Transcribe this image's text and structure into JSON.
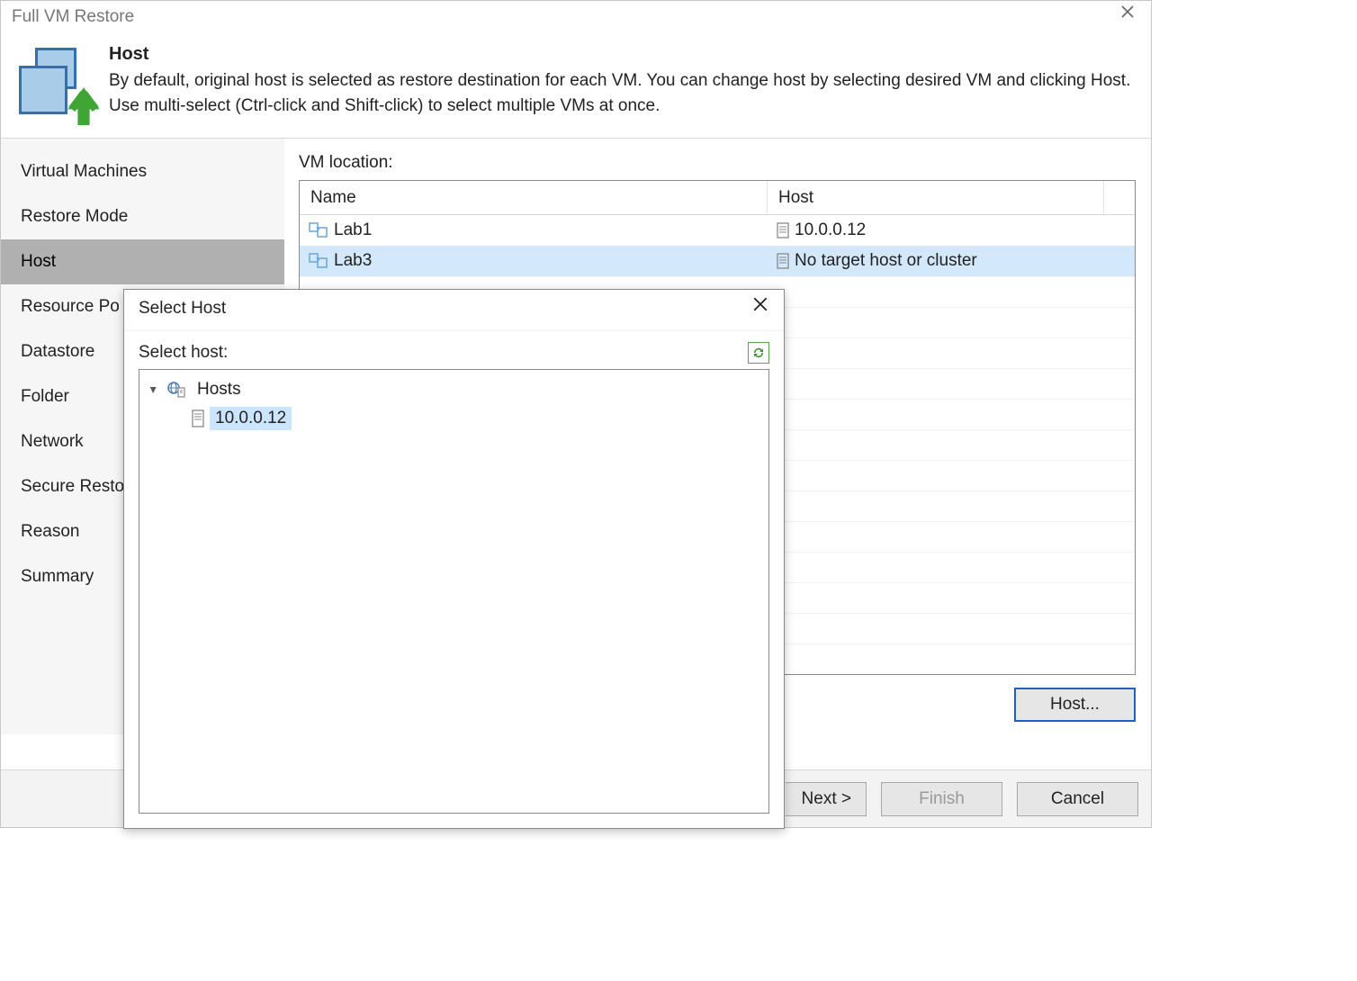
{
  "window": {
    "title": "Full VM Restore"
  },
  "header": {
    "title": "Host",
    "description": "By default, original host is selected as restore destination for each VM. You can change host by selecting desired VM and clicking Host. Use multi-select (Ctrl-click and Shift-click) to select multiple VMs at once."
  },
  "sidebar": {
    "items": [
      {
        "label": "Virtual Machines"
      },
      {
        "label": "Restore Mode"
      },
      {
        "label": "Host"
      },
      {
        "label": "Resource Po"
      },
      {
        "label": "Datastore"
      },
      {
        "label": "Folder"
      },
      {
        "label": "Network"
      },
      {
        "label": "Secure Resto"
      },
      {
        "label": "Reason"
      },
      {
        "label": "Summary"
      }
    ],
    "active_index": 2
  },
  "content": {
    "label": "VM location:",
    "columns": {
      "name": "Name",
      "host": "Host"
    },
    "rows": [
      {
        "name": "Lab1",
        "host": "10.0.0.12",
        "selected": false
      },
      {
        "name": "Lab3",
        "host": "No target host or cluster",
        "selected": true
      }
    ],
    "host_button": "Host..."
  },
  "footer": {
    "next": "Next >",
    "finish": "Finish",
    "cancel": "Cancel"
  },
  "dialog": {
    "title": "Select Host",
    "label": "Select host:",
    "tree": {
      "root": "Hosts",
      "items": [
        {
          "name": "10.0.0.12",
          "selected": true
        }
      ]
    }
  }
}
